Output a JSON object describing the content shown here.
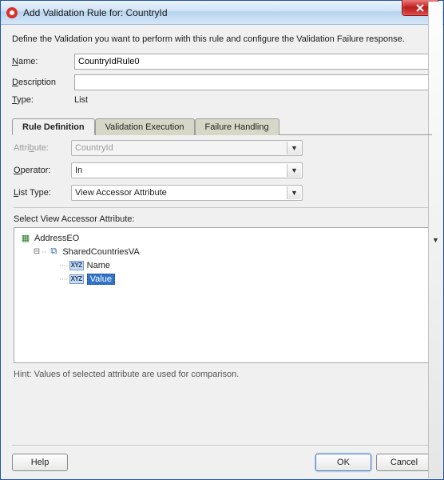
{
  "titlebar": {
    "title": "Add Validation Rule for: CountryId"
  },
  "description": "Define the Validation you want to perform with this rule and configure the Validation Failure response.",
  "form": {
    "name_label_pre": "",
    "name_u": "N",
    "name_label_post": "ame:",
    "name_value": "CountryIdRule0",
    "desc_label_pre": "",
    "desc_u": "D",
    "desc_label_post": "escription",
    "desc_value": "",
    "type_label_pre": "",
    "type_u": "T",
    "type_label_post": "ype:",
    "type_value": "List"
  },
  "tabs": {
    "def_pre": "",
    "def_u": "R",
    "def_post": "ule Definition",
    "exec": "Validation Execution",
    "fail": "Failure Handling"
  },
  "panel": {
    "attr_label_pre": "Attri",
    "attr_u": "b",
    "attr_label_post": "ute:",
    "attr_value": "CountryId",
    "op_label_pre": "",
    "op_u": "O",
    "op_label_post": "perator:",
    "op_value": "In",
    "lt_label_pre": "",
    "lt_u": "L",
    "lt_label_post": "ist Type:",
    "lt_value": "View Accessor Attribute"
  },
  "tree": {
    "heading": "Select View Accessor Attribute:",
    "root": "AddressEO",
    "child1": "SharedCountriesVA",
    "leaf1": "Name",
    "leaf2": "Value"
  },
  "hint": "Hint: Values of selected attribute are used for comparison.",
  "buttons": {
    "help": "Help",
    "ok": "OK",
    "cancel": "Cancel"
  }
}
